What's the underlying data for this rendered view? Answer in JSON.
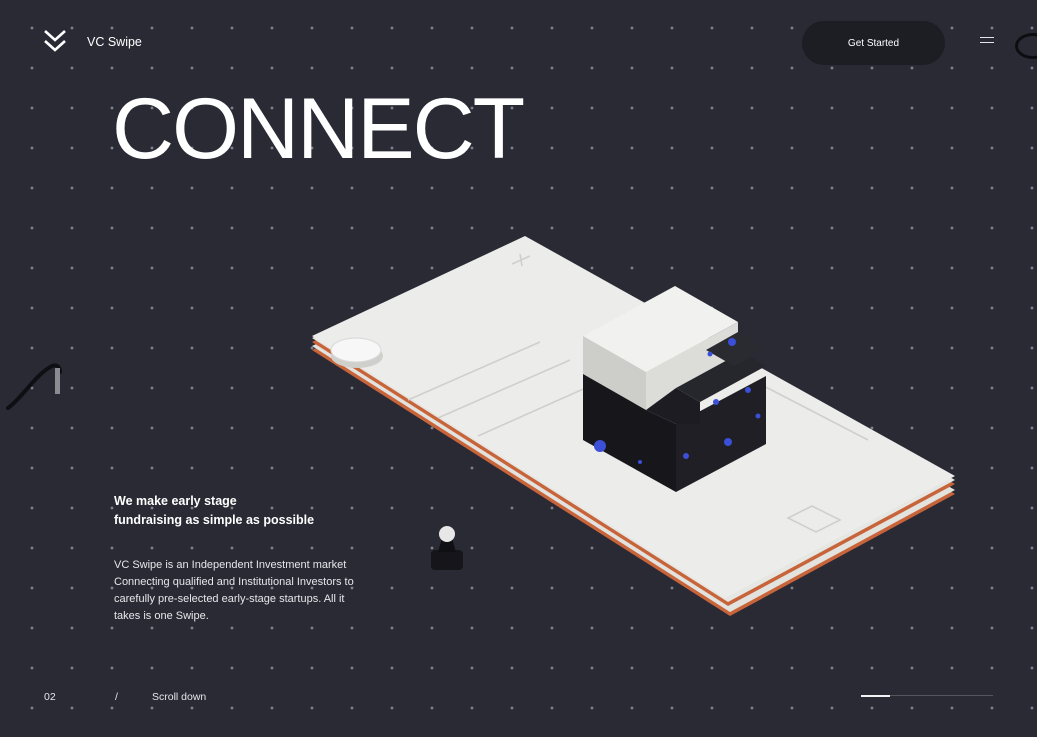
{
  "header": {
    "brand": "VC Swipe",
    "cta_label": "Get Started",
    "logo_icon": "double-chevron-logo-icon",
    "menu_icon": "hamburger-menu-icon"
  },
  "hero": {
    "headline": "CONNECT",
    "subheadline": "We make early stage\nfundraising as simple as possible",
    "description": "VC Swipe is an Independent Investment market Connecting qualified and Institutional Investors to carefully pre-selected early-stage startups. All it takes is one Swipe."
  },
  "footer": {
    "page_number": "02",
    "separator": "/",
    "scroll_label": "Scroll down",
    "progress": 0.22
  },
  "colors": {
    "background": "#2a2a35",
    "button_bg": "#1d1d24",
    "card": "#ececea",
    "card_edge": "#c8643a",
    "cube_dark": "#17171b",
    "accent_blue": "#3b4fd8",
    "text": "#ffffff"
  }
}
